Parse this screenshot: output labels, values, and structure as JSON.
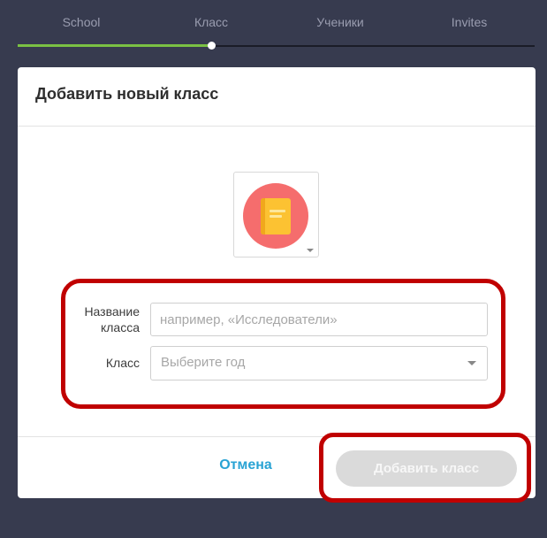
{
  "stepper": {
    "steps": [
      "School",
      "Класс",
      "Ученики",
      "Invites"
    ]
  },
  "modal": {
    "title": "Добавить новый класс",
    "form": {
      "name_label": "Название класса",
      "name_placeholder": "например, «Исследователи»",
      "grade_label": "Класс",
      "grade_placeholder": "Выберите год"
    },
    "footer": {
      "cancel_label": "Отмена",
      "add_label": "Добавить класс"
    }
  },
  "icons": {
    "class_icon": "book-icon",
    "picker_caret": "chevron-down-icon",
    "select_caret": "chevron-down-icon"
  },
  "colors": {
    "progress": "#7ac143",
    "icon_bg": "#f56d6d",
    "book": "#fcc232",
    "link": "#29a3d4",
    "highlight": "#c00000"
  }
}
